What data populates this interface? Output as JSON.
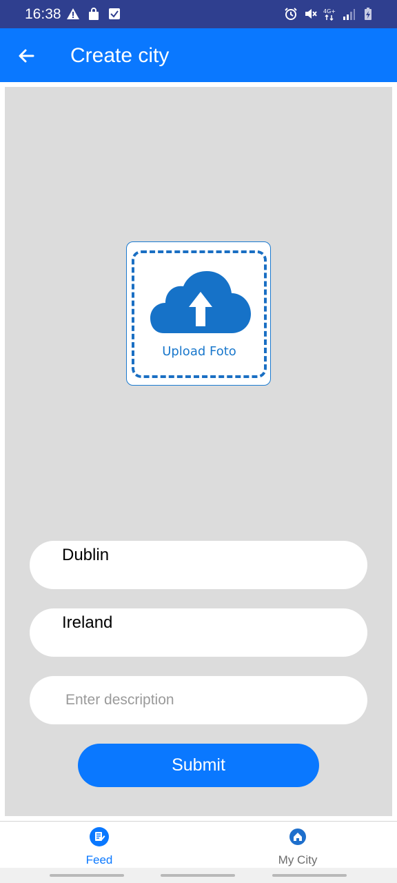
{
  "status_bar": {
    "time": "16:38",
    "left_icons": [
      "warning-icon",
      "bag-icon",
      "check-box-icon"
    ],
    "right_icons": [
      "alarm-icon",
      "mute-icon",
      "network-4g-icon",
      "signal-icon",
      "battery-icon"
    ]
  },
  "app_bar": {
    "title": "Create city",
    "background": "#0a78ff"
  },
  "upload": {
    "label": "Upload Foto"
  },
  "form": {
    "city_value": "Dublin",
    "country_value": "Ireland",
    "description_placeholder": "Enter description",
    "submit_label": "Submit"
  },
  "bottom_nav": {
    "items": [
      {
        "label": "Feed",
        "icon": "feed-icon",
        "active": true
      },
      {
        "label": "My City",
        "icon": "home-icon",
        "active": false
      }
    ]
  },
  "colors": {
    "accent": "#0a78ff",
    "status_bar": "#2f3f8f",
    "content_bg": "#dcdcdc"
  }
}
